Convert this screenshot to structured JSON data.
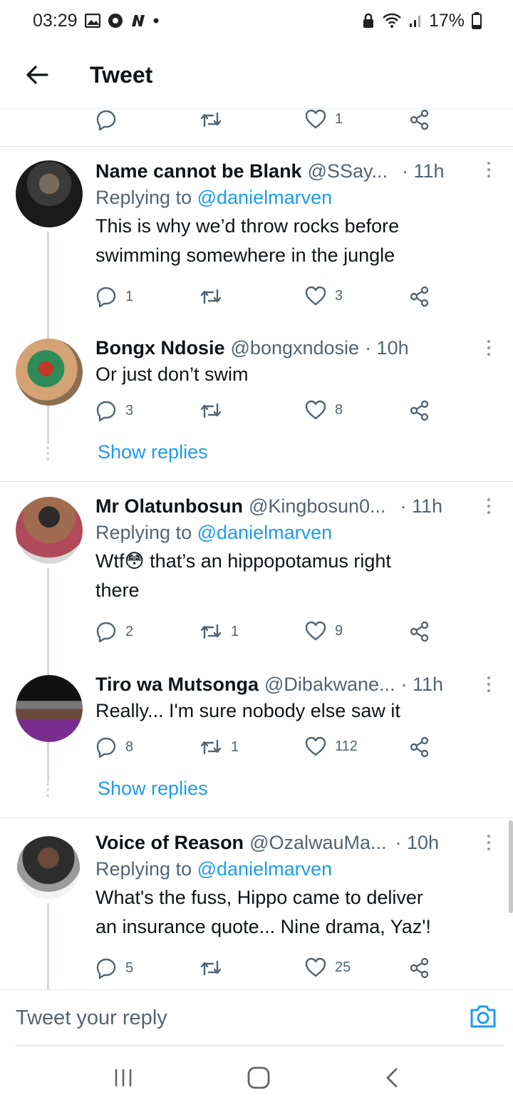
{
  "status": {
    "time": "03:29",
    "battery": "17%"
  },
  "header": {
    "title": "Tweet"
  },
  "prev_actions": {
    "like_count": "1"
  },
  "tweets": [
    {
      "name": "Name cannot be Blank",
      "handle": "@SSay...",
      "time": "· 11h",
      "replying_prefix": "Replying to",
      "replying_to": "@danielmarven",
      "text_lines": [
        "This is why we’d throw rocks before",
        "swimming somewhere in the jungle"
      ],
      "reply_count": "1",
      "retweet_count": "",
      "like_count": "3"
    },
    {
      "name": "Bongx Ndosie",
      "handle": "@bongxndosie",
      "time": "· 10h",
      "text_lines": [
        "Or just don’t swim"
      ],
      "reply_count": "3",
      "retweet_count": "",
      "like_count": "8"
    },
    {
      "name": "Mr Olatunbosun",
      "handle": "@Kingbosun0...",
      "time": "· 11h",
      "replying_prefix": "Replying to",
      "replying_to": "@danielmarven",
      "text_prefix": "Wtf",
      "emoji": "😳",
      "text_lines": [
        "that’s an hippopotamus right",
        "there"
      ],
      "reply_count": "2",
      "retweet_count": "1",
      "like_count": "9"
    },
    {
      "name": "Tiro wa Mutsonga",
      "handle": "@Dibakwane...",
      "time": "· 11h",
      "text_lines": [
        "Really...  I'm sure nobody else saw it"
      ],
      "reply_count": "8",
      "retweet_count": "1",
      "like_count": "112"
    },
    {
      "name": "Voice of Reason",
      "handle": "@OzalwauMa...",
      "time": "· 10h",
      "replying_prefix": "Replying to",
      "replying_to": "@danielmarven",
      "text_lines": [
        "What's the fuss, Hippo came to deliver",
        "an insurance quote... Nine drama, Yaz'!"
      ],
      "reply_count": "5",
      "retweet_count": "",
      "like_count": "25"
    }
  ],
  "show_replies_label": "Show replies",
  "reply_bar": {
    "placeholder": "Tweet your reply"
  },
  "colors": {
    "accent": "#1d9bf0",
    "secondary_text": "#536471",
    "divider": "#e0e6ea"
  }
}
